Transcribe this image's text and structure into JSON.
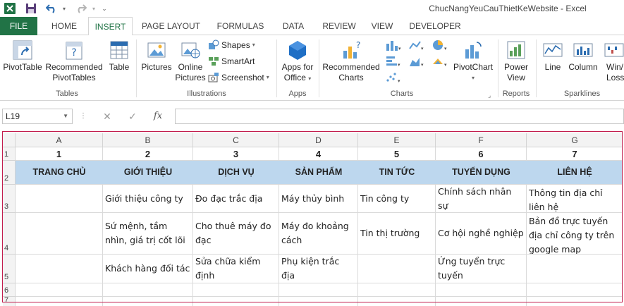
{
  "window": {
    "title": "ChucNangYeuCauThietKeWebsite - Excel"
  },
  "tabs": [
    "FILE",
    "HOME",
    "INSERT",
    "PAGE LAYOUT",
    "FORMULAS",
    "DATA",
    "REVIEW",
    "VIEW",
    "DEVELOPER"
  ],
  "ribbon": {
    "tables": {
      "pivottable": "PivotTable",
      "recommended_1": "Recommended",
      "recommended_2": "PivotTables",
      "table": "Table",
      "group": "Tables"
    },
    "illustrations": {
      "pictures": "Pictures",
      "online_1": "Online",
      "online_2": "Pictures",
      "shapes": "Shapes",
      "smartart": "SmartArt",
      "screenshot": "Screenshot",
      "group": "Illustrations"
    },
    "apps": {
      "apps_1": "Apps for",
      "apps_2": "Office",
      "group": "Apps"
    },
    "charts": {
      "rec_1": "Recommended",
      "rec_2": "Charts",
      "pivotchart": "PivotChart",
      "group": "Charts"
    },
    "reports": {
      "power_1": "Power",
      "power_2": "View",
      "group": "Reports"
    },
    "sparklines": {
      "line": "Line",
      "column": "Column",
      "winloss_1": "Win/",
      "winloss_2": "Loss",
      "group": "Sparklines"
    }
  },
  "formula_bar": {
    "name_box": "L19",
    "formula": ""
  },
  "sheet": {
    "columns": [
      "A",
      "B",
      "C",
      "D",
      "E",
      "F",
      "G"
    ],
    "rows": [
      "1",
      "2",
      "3",
      "4",
      "5",
      "6",
      "7"
    ],
    "numbers": [
      "1",
      "2",
      "3",
      "4",
      "5",
      "6",
      "7"
    ],
    "headers": [
      "TRANG CHỦ",
      "GIỚI THIỆU",
      "DỊCH VỤ",
      "SẢN PHẨM",
      "TIN TỨC",
      "TUYỂN DỤNG",
      "LIÊN HỆ"
    ],
    "row3": [
      "",
      "Giới thiệu công ty",
      "Đo đạc trắc địa",
      "Máy thủy bình",
      "Tin công ty",
      "Chính sách nhân sự",
      "Thông tin địa chỉ liên hệ"
    ],
    "row4": [
      "",
      "Sứ mệnh, tầm nhìn, giá trị cốt lõi",
      "Cho thuê máy đo đạc",
      "Máy đo khoảng cách",
      "Tin thị trường",
      "Cơ hội nghề nghiệp",
      "Bản đồ trực tuyến địa chỉ công ty trên google map"
    ],
    "row5": [
      "",
      "Khách hàng đối tác",
      "Sửa chữa kiểm định",
      "Phụ kiện trắc địa",
      "",
      "Ứng tuyển trực tuyến",
      ""
    ]
  },
  "colors": {
    "accent": "#217346",
    "header_fill": "#bdd7ee",
    "frame": "#c21d4d"
  }
}
